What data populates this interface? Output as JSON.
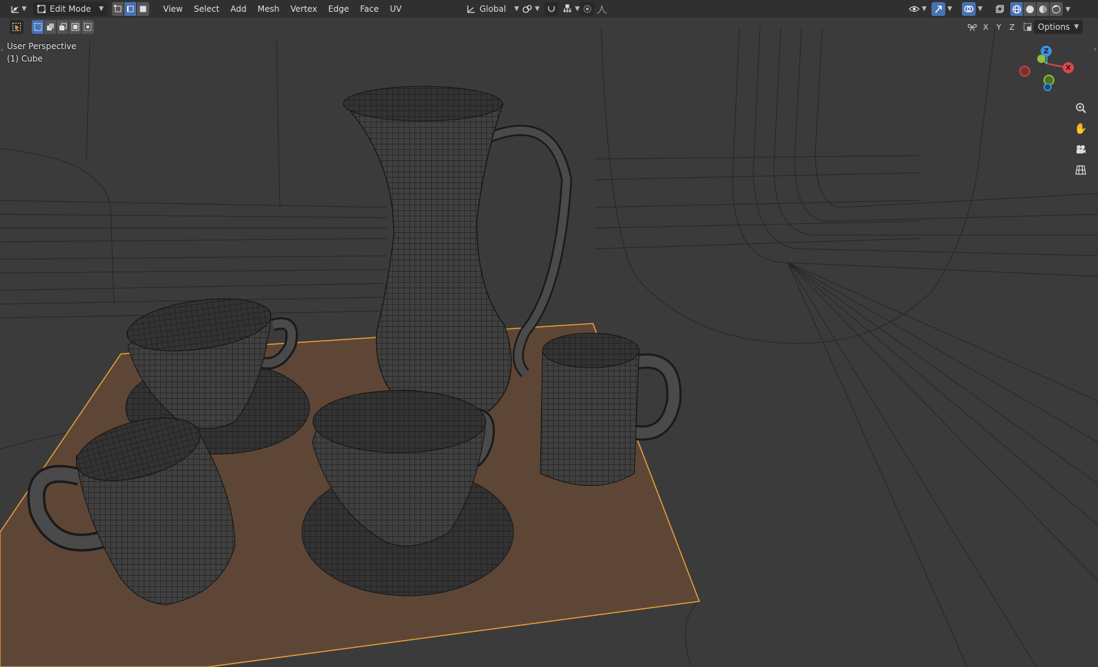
{
  "header": {
    "editor_type_icon": "3d-viewport-icon",
    "mode": "Edit Mode",
    "select_modes": [
      "vertex-select-icon",
      "edge-select-icon",
      "face-select-icon"
    ],
    "menu": [
      "View",
      "Select",
      "Add",
      "Mesh",
      "Vertex",
      "Edge",
      "Face",
      "UV"
    ],
    "transform_orientation": "Global",
    "pivot_icon": "pivot-point-icon",
    "snap_icon": "snap-magnet-icon",
    "snap_target_icon": "snap-increment-icon",
    "proportional_icon": "proportional-edit-icon",
    "falloff_icon": "falloff-curve-icon"
  },
  "header_right": {
    "visibility_icon": "eye-icon",
    "gizmo_icon": "gizmo-arrow-icon",
    "overlay_icon": "overlay-circles-icon",
    "xray_icon": "xray-icon",
    "shading_icons": [
      "wireframe-shading-icon",
      "solid-shading-icon",
      "material-shading-icon",
      "rendered-shading-icon"
    ]
  },
  "toolrow": {
    "select_tool_icon": "select-box-icon",
    "select_mode_icons": [
      "new-selection-icon",
      "extend-selection-icon",
      "subtract-selection-icon",
      "invert-selection-icon",
      "intersect-selection-icon"
    ],
    "mirror_icon": "mirror-butterfly-icon",
    "axes": [
      "X",
      "Y",
      "Z"
    ],
    "options_label": "Options"
  },
  "viewport": {
    "view_name": "User Perspective",
    "object_name": "(1) Cube"
  },
  "gizmo": {
    "z_label": "Z",
    "x_label": "X",
    "colors": {
      "x": "#e0464a",
      "y": "#8bbf3c",
      "z": "#3d8fe0"
    }
  },
  "nav_icons": [
    "zoom-icon",
    "pan-hand-icon",
    "camera-icon",
    "grid-ortho-icon"
  ],
  "colors": {
    "background": "#3b3b3b",
    "header": "#303030",
    "active_button": "#4772b3",
    "tray": "#5e4636",
    "selected_edge": "#f0a23a",
    "wire": "#1a1a1a"
  }
}
